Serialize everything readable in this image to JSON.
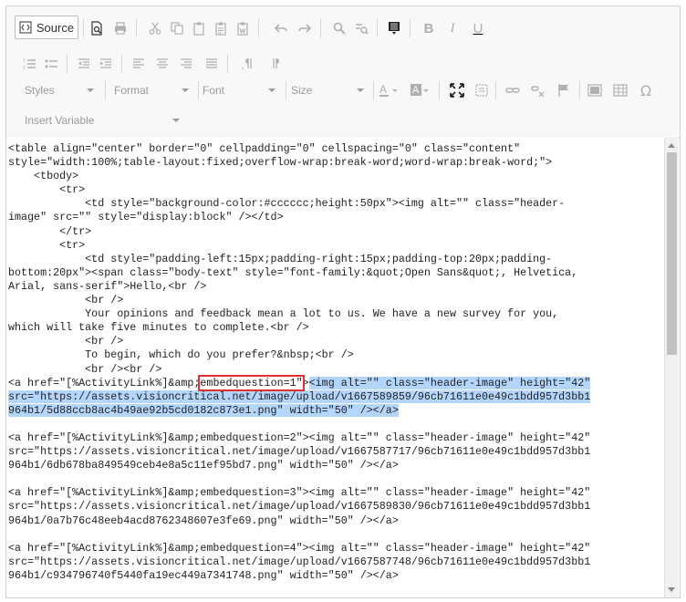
{
  "toolbar": {
    "source_label": "Source",
    "styles_label": "Styles",
    "format_label": "Format",
    "font_label": "Font",
    "size_label": "Size",
    "insert_variable_label": "Insert Variable",
    "icons": [
      "source-icon",
      "preview-icon",
      "print-icon",
      "cut-icon",
      "copy-icon",
      "paste-icon",
      "paste-text-icon",
      "paste-word-icon",
      "undo-icon",
      "redo-icon",
      "find-icon",
      "replace-icon",
      "template-icon",
      "bold-icon",
      "italic-icon",
      "underline-icon",
      "numbered-list-icon",
      "bulleted-list-icon",
      "outdent-icon",
      "indent-icon",
      "align-left-icon",
      "align-center-icon",
      "align-right-icon",
      "justify-icon",
      "ltr-icon",
      "rtl-icon",
      "text-color-icon",
      "background-color-icon",
      "maximize-icon",
      "show-blocks-icon",
      "link-icon",
      "unlink-icon",
      "anchor-icon",
      "image-icon",
      "table-icon",
      "special-char-icon"
    ],
    "colors": {
      "enabled": "#333333",
      "disabled": "#b0b0b0",
      "active": "#222222"
    }
  },
  "code": {
    "highlight_token": "embedquestion=1",
    "selection_color": "#b4d5fe",
    "highlight_border": "#e03030",
    "lines": [
      "<table align=\"center\" border=\"0\" cellpadding=\"0\" cellspacing=\"0\" class=\"content\"",
      "style=\"width:100%;table-layout:fixed;overflow-wrap:break-word;word-wrap:break-word;\">",
      "    <tbody>",
      "        <tr>",
      "            <td style=\"background-color:#cccccc;height:50px\"><img alt=\"\" class=\"header-",
      "image\" src=\"\" style=\"display:block\" /></td>",
      "        </tr>",
      "        <tr>",
      "            <td style=\"padding-left:15px;padding-right:15px;padding-top:20px;padding-",
      "bottom:20px\"><span class=\"body-text\" style=\"font-family:&quot;Open Sans&quot;, Helvetica,",
      "Arial, sans-serif\">Hello,<br />",
      "            <br />",
      "            Your opinions and feedback mean a lot to us. We have a new survey for you,",
      "which will take five minutes to complete.<br />",
      "            <br />",
      "            To begin, which do you prefer?&nbsp;<br />",
      "            <br /><br />",
      "<a href=\"[%ActivityLink%]&amp;embedquestion=1\"><img alt=\"\" class=\"header-image\" height=\"42\"",
      "src=\"https://assets.visioncritical.net/image/upload/v1667589859/96cb71611e0e49c1bdd957d3bb1",
      "964b1/5d88ccb8ac4b49ae92b5cd0182c873e1.png\" width=\"50\" /></a>",
      "",
      "<a href=\"[%ActivityLink%]&amp;embedquestion=2\"><img alt=\"\" class=\"header-image\" height=\"42\"",
      "src=\"https://assets.visioncritical.net/image/upload/v1667587717/96cb71611e0e49c1bdd957d3bb1",
      "964b1/6db678ba849549ceb4e8a5c11ef95bd7.png\" width=\"50\" /></a>",
      "",
      "<a href=\"[%ActivityLink%]&amp;embedquestion=3\"><img alt=\"\" class=\"header-image\" height=\"42\"",
      "src=\"https://assets.visioncritical.net/image/upload/v1667589830/96cb71611e0e49c1bdd957d3bb1",
      "964b1/0a7b76c48eeb4acd8762348607e3fe69.png\" width=\"50\" /></a>",
      "",
      "<a href=\"[%ActivityLink%]&amp;embedquestion=4\"><img alt=\"\" class=\"header-image\" height=\"42\"",
      "src=\"https://assets.visioncritical.net/image/upload/v1667587748/96cb71611e0e49c1bdd957d3bb1",
      "964b1/c934796740f5440fa19ec449a7341748.png\" width=\"50\" /></a>",
      ""
    ]
  }
}
